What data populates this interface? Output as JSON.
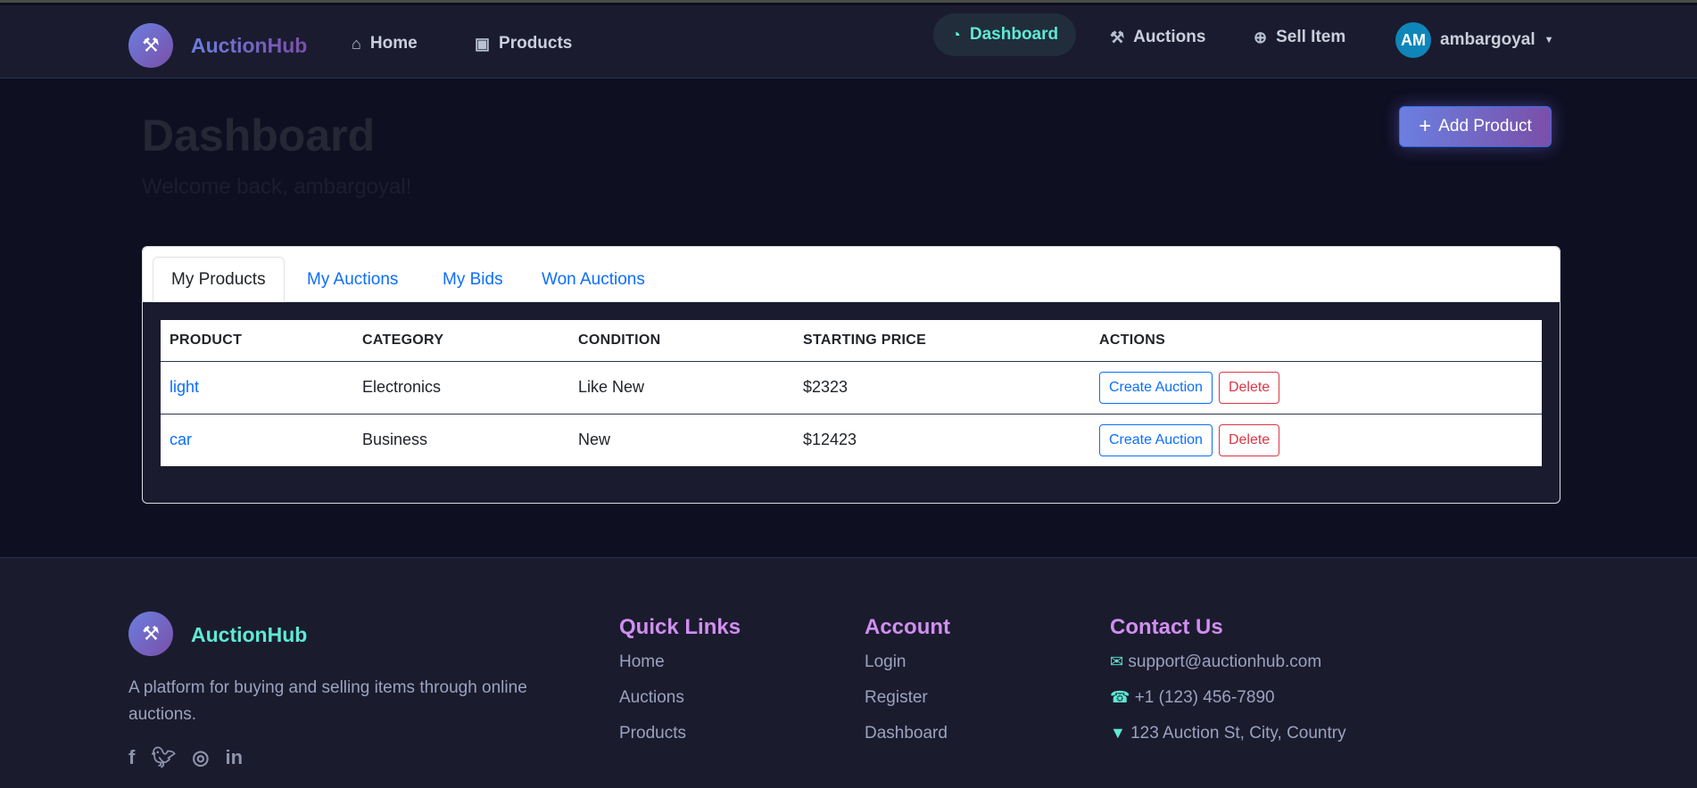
{
  "nav": {
    "brand": "AuctionHub",
    "left": [
      {
        "label": "Home",
        "icon": "home-icon"
      },
      {
        "label": "Products",
        "icon": "box-icon"
      }
    ],
    "right": [
      {
        "label": "Dashboard",
        "icon": "dashboard-icon"
      },
      {
        "label": "Auctions",
        "icon": "gavel-icon"
      },
      {
        "label": "Sell Item",
        "icon": "plus-circle-icon"
      }
    ],
    "user": {
      "initials": "AM",
      "name": "ambargoyal"
    }
  },
  "header": {
    "title": "Dashboard",
    "welcome": "Welcome back, ambargoyal!",
    "add_button": "Add Product"
  },
  "tabs": [
    "My Products",
    "My Auctions",
    "My Bids",
    "Won Auctions"
  ],
  "table": {
    "headers": [
      "PRODUCT",
      "CATEGORY",
      "CONDITION",
      "STARTING PRICE",
      "ACTIONS"
    ],
    "rows": [
      {
        "product": "light",
        "category": "Electronics",
        "condition": "Like New",
        "price": "$2323"
      },
      {
        "product": "car",
        "category": "Business",
        "condition": "New",
        "price": "$12423"
      }
    ],
    "create_label": "Create Auction",
    "delete_label": "Delete"
  },
  "footer": {
    "brand": "AuctionHub",
    "description": "A platform for buying and selling items through online auctions.",
    "quick_links": {
      "title": "Quick Links",
      "items": [
        "Home",
        "Auctions",
        "Products"
      ]
    },
    "account": {
      "title": "Account",
      "items": [
        "Login",
        "Register",
        "Dashboard"
      ]
    },
    "contact": {
      "title": "Contact Us",
      "email": "support@auctionhub.com",
      "phone": "+1 (123) 456-7890",
      "address": "123 Auction St, City, Country"
    }
  },
  "colors": {
    "accent": "#5eead4",
    "link": "#0d6efd",
    "danger": "#dc3545",
    "heading": "#d08ff0"
  }
}
